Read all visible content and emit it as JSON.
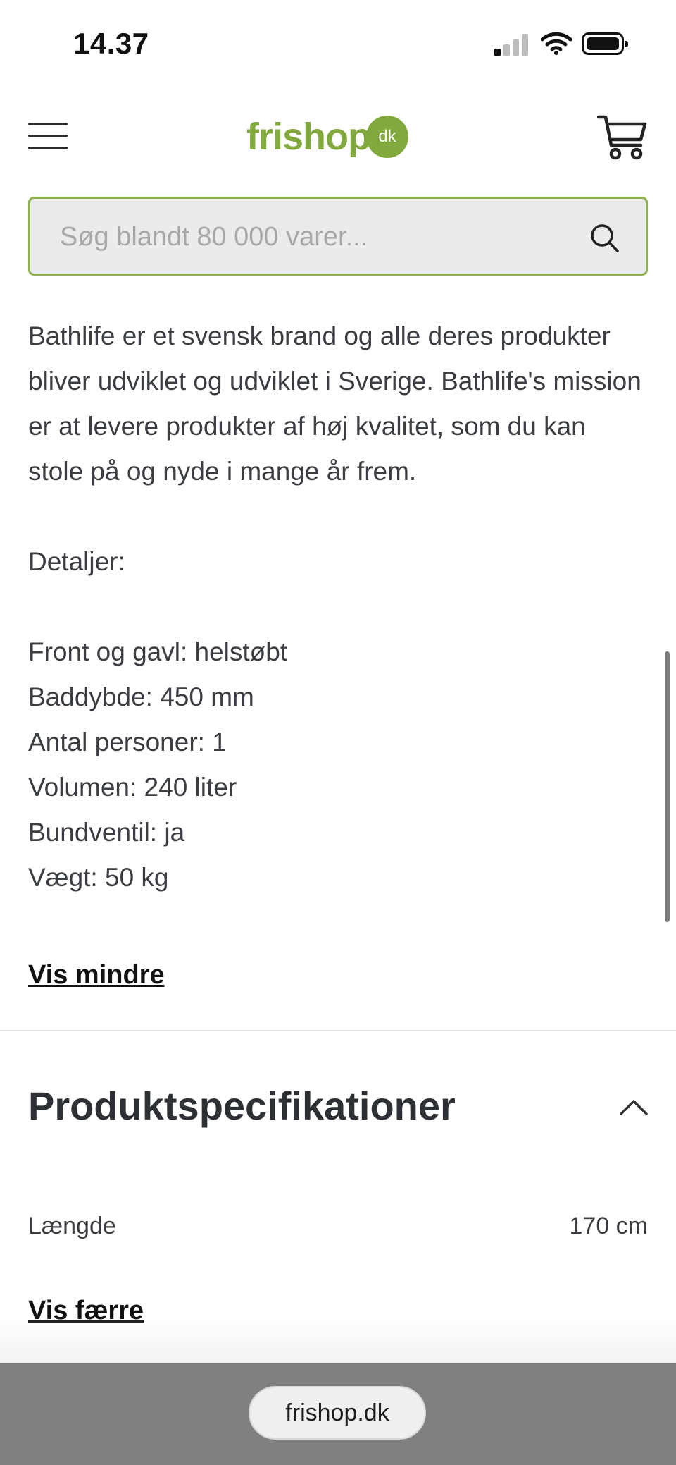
{
  "status": {
    "time": "14.37"
  },
  "header": {
    "logo_main": "frishop",
    "logo_badge": "dk"
  },
  "search": {
    "placeholder": "Søg blandt 80 000 varer..."
  },
  "description": {
    "paragraph": "Bathlife er et svensk brand og alle deres produkter bliver udviklet og udviklet i Sverige. Bathlife's mission er at levere produkter af høj kvalitet, som du kan stole på og nyde i mange år frem.",
    "details_heading": "Detaljer:",
    "details": [
      "Front og gavl: helstøbt",
      "Baddybde: 450 mm",
      "Antal personer: 1",
      "Volumen: 240 liter",
      "Bundventil: ja",
      "Vægt: 50 kg"
    ],
    "toggle_label": "Vis mindre"
  },
  "specs": {
    "title": "Produktspecifikationer",
    "rows": [
      {
        "label": "Længde",
        "value": "170 cm"
      }
    ],
    "toggle_label": "Vis færre"
  },
  "browser": {
    "url": "frishop.dk"
  },
  "colors": {
    "brand": "#82a93d",
    "search_border": "#8fb04e",
    "bottom_bar": "#808080"
  }
}
